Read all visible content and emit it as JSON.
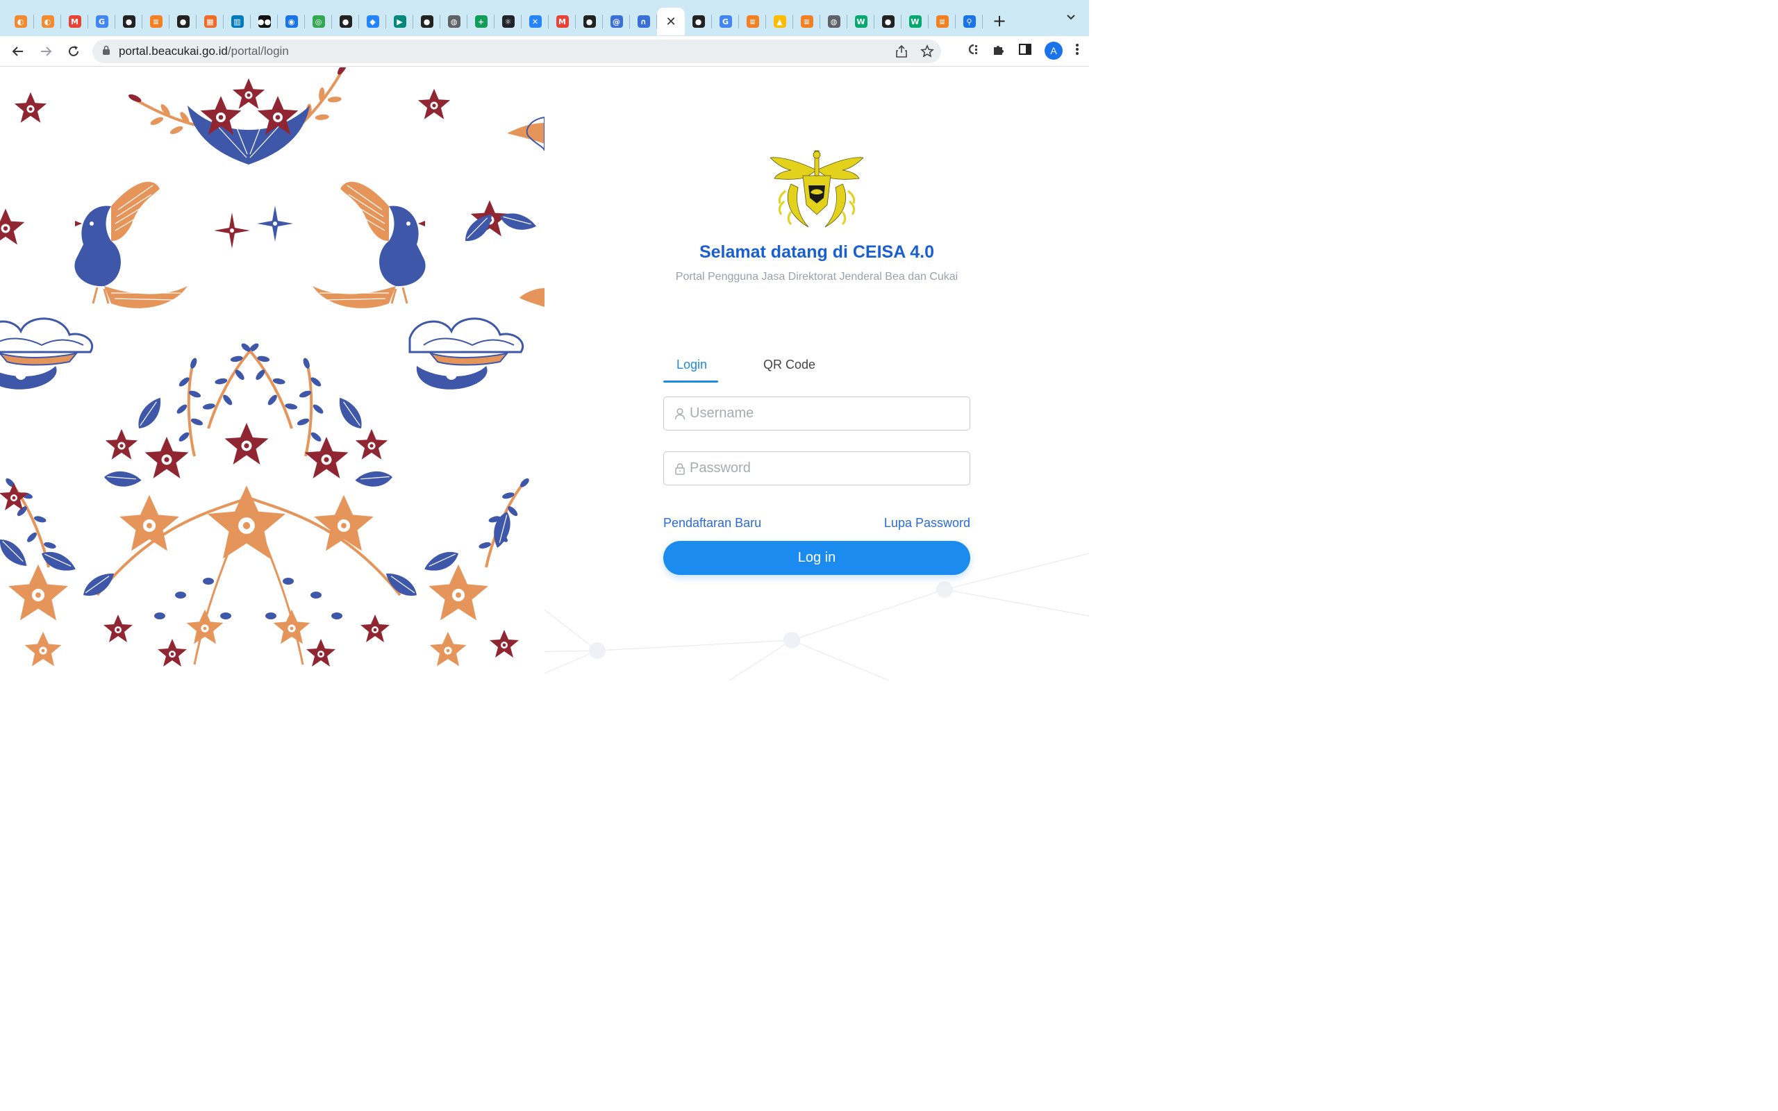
{
  "browser": {
    "tabs": [
      {
        "icon": "swift-fruit-icon",
        "color": "#f28b30",
        "glyph": "◐"
      },
      {
        "icon": "swift-fruit-icon",
        "color": "#f28b30",
        "glyph": "◐"
      },
      {
        "icon": "gmail-icon",
        "color": "#ea4335",
        "glyph": "M"
      },
      {
        "icon": "google-icon",
        "color": "#4285f4",
        "glyph": "G"
      },
      {
        "icon": "github-icon",
        "color": "#222222",
        "glyph": "●"
      },
      {
        "icon": "stackoverflow-icon",
        "color": "#f48024",
        "glyph": "≡"
      },
      {
        "icon": "github-icon",
        "color": "#222222",
        "glyph": "●"
      },
      {
        "icon": "orange-blocks-icon",
        "color": "#f06a28",
        "glyph": "▦"
      },
      {
        "icon": "trello-icon",
        "color": "#0079bf",
        "glyph": "▥"
      },
      {
        "icon": "medium-icon",
        "color": "#111111",
        "glyph": "●●"
      },
      {
        "icon": "maps-pin-icon",
        "color": "#1a73e8",
        "glyph": "◉"
      },
      {
        "icon": "tripadvisor-icon",
        "color": "#34a853",
        "glyph": "◎"
      },
      {
        "icon": "github-icon",
        "color": "#222222",
        "glyph": "●"
      },
      {
        "icon": "jira-icon",
        "color": "#2684ff",
        "glyph": "◆"
      },
      {
        "icon": "google-meet-icon",
        "color": "#00897b",
        "glyph": "▶"
      },
      {
        "icon": "github-icon",
        "color": "#222222",
        "glyph": "●"
      },
      {
        "icon": "globe-icon",
        "color": "#5f6368",
        "glyph": "◍"
      },
      {
        "icon": "google-sheets-plus-icon",
        "color": "#0f9d58",
        "glyph": "+"
      },
      {
        "icon": "react-icon",
        "color": "#20232a",
        "glyph": "⚛"
      },
      {
        "icon": "confluence-icon",
        "color": "#2684ff",
        "glyph": "✕"
      },
      {
        "icon": "gmail-icon",
        "color": "#ea4335",
        "glyph": "M"
      },
      {
        "icon": "github-icon",
        "color": "#222222",
        "glyph": "●"
      },
      {
        "icon": "swirl-app-icon",
        "color": "#3b6fd8",
        "glyph": "@"
      },
      {
        "icon": "arch-app-icon",
        "color": "#3b6fd8",
        "glyph": "∩"
      },
      {
        "icon": "close-icon",
        "active": true,
        "glyph": "✕"
      },
      {
        "icon": "github-icon",
        "color": "#222222",
        "glyph": "●"
      },
      {
        "icon": "google-icon",
        "color": "#4285f4",
        "glyph": "G"
      },
      {
        "icon": "stackoverflow-icon",
        "color": "#f48024",
        "glyph": "≡"
      },
      {
        "icon": "google-drive-icon",
        "color": "#fbbc04",
        "glyph": "▲"
      },
      {
        "icon": "stackoverflow-icon",
        "color": "#f48024",
        "glyph": "≡"
      },
      {
        "icon": "globe-icon",
        "color": "#5f6368",
        "glyph": "◍"
      },
      {
        "icon": "w3schools-icon",
        "color": "#04aa6d",
        "glyph": "W"
      },
      {
        "icon": "github-icon",
        "color": "#222222",
        "glyph": "●"
      },
      {
        "icon": "w3schools-icon",
        "color": "#04aa6d",
        "glyph": "W"
      },
      {
        "icon": "stackoverflow-icon",
        "color": "#f48024",
        "glyph": "≡"
      },
      {
        "icon": "lens-icon",
        "color": "#1a73e8",
        "glyph": "⚲"
      }
    ],
    "new_tab_label": "+",
    "url_host": "portal.beacukai.go.id",
    "url_path": "/portal/login",
    "avatar_letter": "A"
  },
  "login": {
    "welcome": "Selamat datang di CEISA 4.0",
    "subtitle": "Portal Pengguna Jasa Direktorat Jenderal Bea dan Cukai",
    "tab_login": "Login",
    "tab_qr": "QR Code",
    "username_placeholder": "Username",
    "password_placeholder": "Password",
    "register_link": "Pendaftaran Baru",
    "forgot_link": "Lupa Password",
    "submit_label": "Log in"
  },
  "colors": {
    "accent": "#1c8bf0",
    "title": "#1a5fd0",
    "link": "#2a6bd8",
    "batik_red": "#8f2631",
    "batik_blue": "#3e57a8",
    "batik_orange": "#e6955a",
    "logo_gold": "#e3d21c"
  }
}
